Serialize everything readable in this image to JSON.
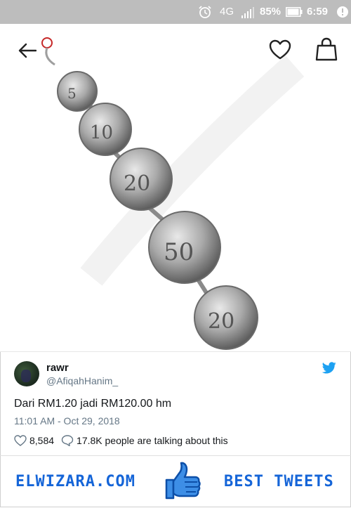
{
  "status_bar": {
    "network": "4G",
    "battery": "85%",
    "time": "6:59"
  },
  "product": {
    "icons": [
      "back-arrow-icon",
      "heart-icon",
      "shopping-bag-icon"
    ],
    "image": "coin-bracelet"
  },
  "tweet": {
    "name": "rawr",
    "handle": "@AfiqahHanim_",
    "text": "Dari RM1.20 jadi RM120.00 hm",
    "timestamp": "11:01 AM - Oct 29, 2018",
    "likes": "8,584",
    "talking": "17.8K people are talking about this",
    "accent_color": "#1da1f2"
  },
  "footer": {
    "left": "ELWIZARA.COM",
    "right": "BEST TWEETS",
    "accent_color": "#1565d8"
  }
}
